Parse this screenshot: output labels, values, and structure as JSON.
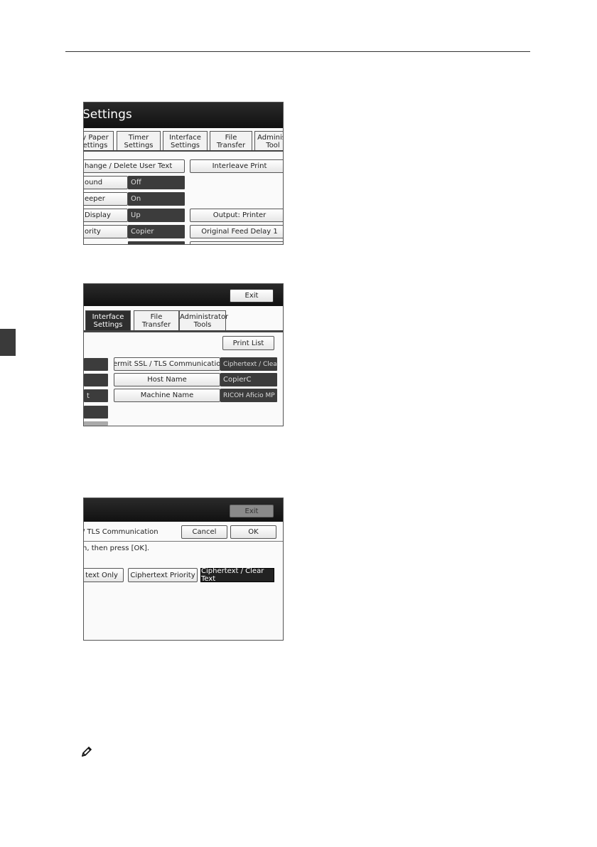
{
  "shot1": {
    "title": "Settings",
    "tabs": [
      {
        "label": "y Paper\nettings"
      },
      {
        "label": "Timer\nSettings"
      },
      {
        "label": "Interface\nSettings"
      },
      {
        "label": "File\nTransfer"
      },
      {
        "label": "Administ\nTool"
      }
    ],
    "row0_left": "hange / Delete User Text",
    "row0_right": "Interleave Print",
    "rows": [
      {
        "label": "ound",
        "value": "Off"
      },
      {
        "label": "eeper",
        "value": "On"
      },
      {
        "label": "Display",
        "value": "Up"
      },
      {
        "label": "ority",
        "value": "Copier"
      }
    ],
    "right_btn_1": "Output: Printer",
    "right_btn_2": "Original Feed Delay 1"
  },
  "shot2": {
    "exit": "Exit",
    "tabs": [
      {
        "label": "Interface\nSettings"
      },
      {
        "label": "File\nTransfer"
      },
      {
        "label": "Administrator\nTools"
      }
    ],
    "print_list": "Print List",
    "left_partial": "t",
    "items": [
      {
        "label": "Permit SSL / TLS Communication",
        "value": "Ciphertext / Clear Text"
      },
      {
        "label": "Host Name",
        "value": "CopierC"
      },
      {
        "label": "Machine Name",
        "value": "RICOH Aficio MP"
      }
    ]
  },
  "shot3": {
    "exit": "Exit",
    "dialog_title": "/ TLS Communication",
    "cancel": "Cancel",
    "ok": "OK",
    "instruction": "n, then press [OK].",
    "options": [
      {
        "label": "text Only"
      },
      {
        "label": "Ciphertext Priority"
      },
      {
        "label": "Ciphertext / Clear Text"
      }
    ]
  },
  "icons": {
    "note": "pencil-note-icon"
  }
}
